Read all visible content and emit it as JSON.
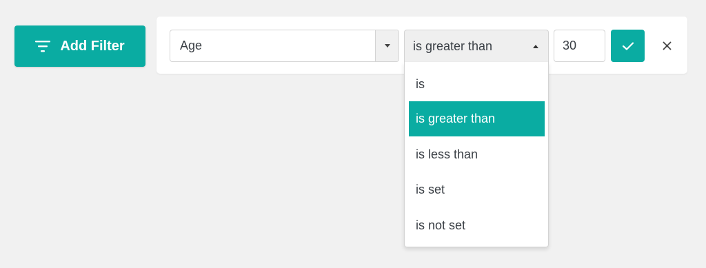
{
  "toolbar": {
    "add_filter_label": "Add Filter",
    "add_filter_icon": "filter-list-icon"
  },
  "filter": {
    "field": {
      "selected": "Age",
      "icon": "chevron-down-icon"
    },
    "operator": {
      "selected": "is greater than",
      "open": true,
      "icon": "chevron-up-icon",
      "options": [
        {
          "label": "is",
          "selected": false
        },
        {
          "label": "is greater than",
          "selected": true
        },
        {
          "label": "is less than",
          "selected": false
        },
        {
          "label": "is set",
          "selected": false
        },
        {
          "label": "is not set",
          "selected": false
        }
      ]
    },
    "value": "30",
    "apply_icon": "checkmark-icon",
    "remove_icon": "close-icon"
  },
  "colors": {
    "accent": "#0aaca2",
    "background": "#f1f1f1",
    "panel": "#ffffff",
    "text": "#3a3f45"
  }
}
